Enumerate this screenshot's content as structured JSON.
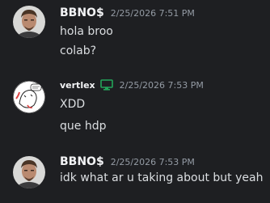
{
  "colors": {
    "background": "#1e1f22",
    "username": "#f2f3f5",
    "timestamp": "#949ba4",
    "message_text": "#dbdee1",
    "monitor_icon": "#23a55a"
  },
  "messages": [
    {
      "username": "BBNO$",
      "timestamp": "2/25/2026 7:51 PM",
      "avatar_icon": "user-avatar-photo",
      "lines": [
        "hola broo",
        "colab?"
      ]
    },
    {
      "username": "vertlex",
      "timestamp": "2/25/2026 7:53 PM",
      "avatar_icon": "user-avatar-sketch",
      "badge_icon": "monitor-icon",
      "lines": [
        "XDD",
        "que hdp"
      ]
    },
    {
      "username": "BBNO$",
      "timestamp": "2/25/2026 7:53 PM",
      "avatar_icon": "user-avatar-photo",
      "lines": [
        "idk what ar u taking about but yeah"
      ]
    }
  ]
}
